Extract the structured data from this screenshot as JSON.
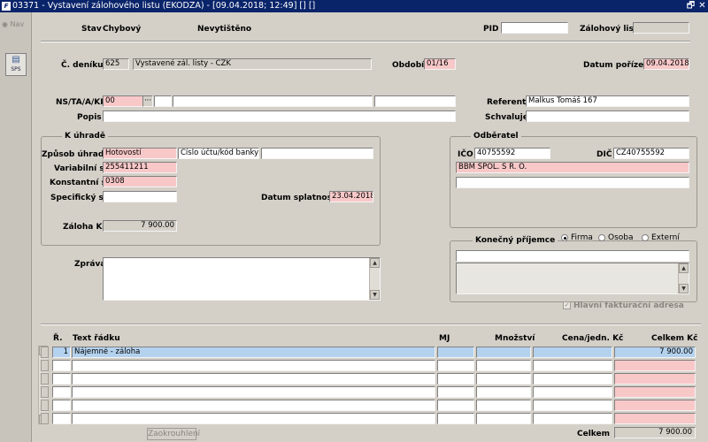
{
  "window": {
    "title": "03371 - Vystavení zálohového listu (EKODZA) - [09.04.2018; 12:49] [] []",
    "app_icon": "F",
    "restore_icon": "🗗",
    "close_icon": "✕"
  },
  "sidebar": {
    "nav_label": "Nav",
    "sps_label": "SPS"
  },
  "header": {
    "stav_label": "Stav",
    "stav_value": "Chybový",
    "print_status": "Nevytištěno",
    "pid_label": "PID",
    "pid_value": "",
    "zalohovy_list_label": "Zálohový list",
    "zalohovy_list_value": ""
  },
  "journal": {
    "cislo_deniku_label": "Č. deníku",
    "cislo_deniku_value": "625",
    "deniku_name": "Vystavené zál. listy - CZK",
    "obdobi_label": "Období",
    "obdobi_value": "01/16",
    "datum_porizeni_label": "Datum pořízení",
    "datum_porizeni_value": "09.04.2018"
  },
  "ns": {
    "label": "NS/TA/A/KP",
    "value1": "00",
    "lookup_label": "···",
    "value2": "",
    "value3": "",
    "value4": "",
    "referent_label": "Referent",
    "referent_value": "Malkus Tomáš 167",
    "popis_label": "Popis",
    "popis_value": "",
    "schvaluje_label": "Schvaluje",
    "schvaluje_value": ""
  },
  "k_uhrade": {
    "title": "K úhradě",
    "zpusob_label": "Způsob úhrady",
    "zpusob_value": "Hotovostí",
    "ucet_placeholder": "Číslo účtu/kód banky",
    "ucet_value": "",
    "variabilni_label": "Variabilní s.",
    "variabilni_value": "255411211",
    "konstantni_label": "Konstantní s.",
    "konstantni_value": "0308",
    "specificky_label": "Specifický s.",
    "specificky_value": "",
    "splatnost_label": "Datum splatnosti",
    "splatnost_value": "23.04.2018",
    "zaloha_label": "Záloha Kč",
    "zaloha_value": "7 900.00"
  },
  "odberatel": {
    "title": "Odběratel",
    "ico_label": "IČO",
    "ico_value": "40755592",
    "dic_label": "DIČ",
    "dic_value": "CZ40755592",
    "name": "BBM SPOL. S R. O.",
    "address": ""
  },
  "zprava": {
    "label": "Zpráva",
    "value": ""
  },
  "konecny": {
    "title": "Konečný příjemce",
    "options": [
      "Firma",
      "Osoba",
      "Externí"
    ],
    "selected": "Firma",
    "name_value": "",
    "checkbox_label": "Hlavní fakturační adresa",
    "checkbox_checked": true
  },
  "table": {
    "headers": {
      "r": "Ř.",
      "text": "Text řádku",
      "mj": "MJ",
      "mnozstvi": "Množství",
      "cena": "Cena/jedn. Kč",
      "celkem": "Celkem Kč"
    },
    "rows": [
      {
        "r": "1",
        "text": "Nájemné - záloha",
        "mj": "",
        "mnozstvi": "",
        "cena": "",
        "celkem": "7 900.00"
      },
      {
        "r": "",
        "text": "",
        "mj": "",
        "mnozstvi": "",
        "cena": "",
        "celkem": ""
      },
      {
        "r": "",
        "text": "",
        "mj": "",
        "mnozstvi": "",
        "cena": "",
        "celkem": ""
      },
      {
        "r": "",
        "text": "",
        "mj": "",
        "mnozstvi": "",
        "cena": "",
        "celkem": ""
      },
      {
        "r": "",
        "text": "",
        "mj": "",
        "mnozstvi": "",
        "cena": "",
        "celkem": ""
      },
      {
        "r": "",
        "text": "",
        "mj": "",
        "mnozstvi": "",
        "cena": "",
        "celkem": ""
      }
    ],
    "zaokrouhleni_label": "Zaokrouhlení",
    "celkem_label": "Celkem",
    "celkem_value": "7 900.00"
  },
  "colors": {
    "title_bar": "#0a246a",
    "required_field": "#f8c8c8",
    "selected_row": "#b4d2ee",
    "window_bg": "#d4d0c8"
  }
}
